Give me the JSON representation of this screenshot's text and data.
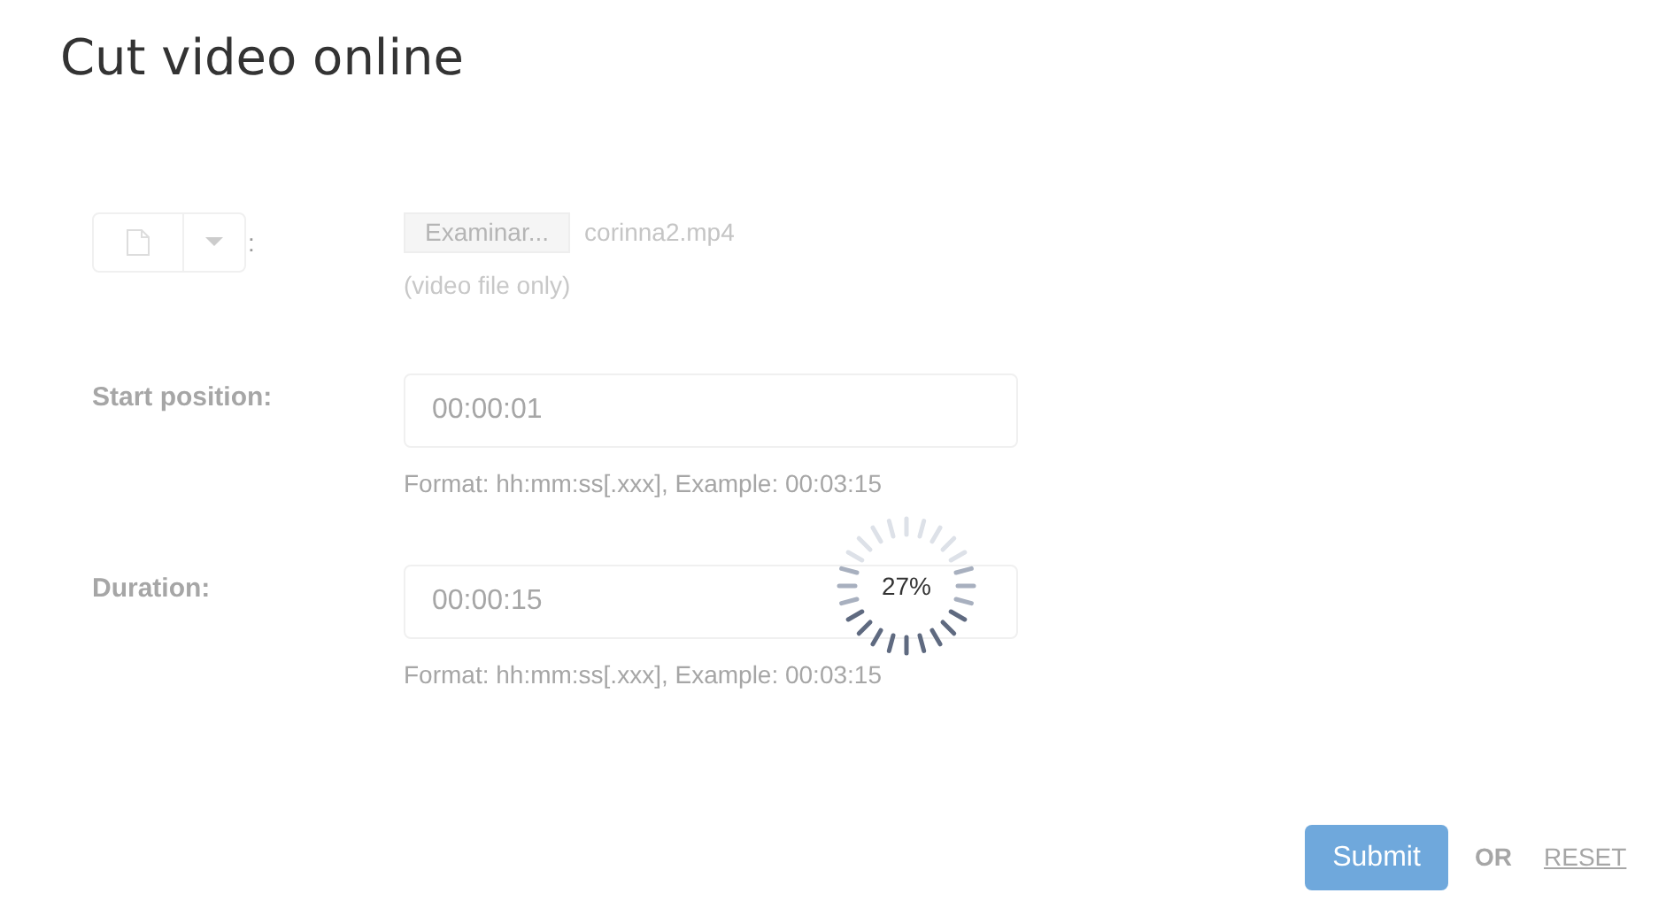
{
  "title": "Cut video online",
  "file_row": {
    "label": ":",
    "browse_button": "Examinar...",
    "file_name": "corinna2.mp4",
    "hint": "(video file only)"
  },
  "fields": [
    {
      "label": "Start position:",
      "value": "00:00:01",
      "hint": "Format: hh:mm:ss[.xxx], Example: 00:03:15"
    },
    {
      "label": "Duration:",
      "value": "00:00:15",
      "hint": "Format: hh:mm:ss[.xxx], Example: 00:03:15"
    }
  ],
  "progress": {
    "text": "27%"
  },
  "actions": {
    "submit": "Submit",
    "separator": "OR",
    "reset": "RESET"
  }
}
